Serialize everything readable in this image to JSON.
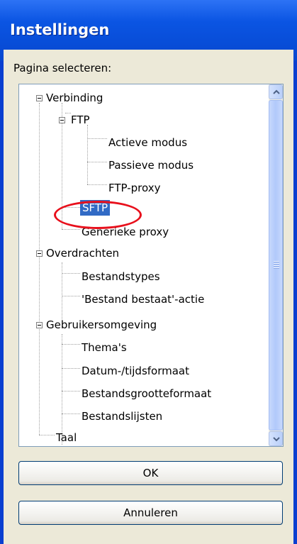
{
  "window": {
    "title": "Instellingen"
  },
  "page_select_label": "Pagina selecteren:",
  "tree": {
    "verbinding": "Verbinding",
    "ftp": "FTP",
    "actieve_modus": "Actieve modus",
    "passieve_modus": "Passieve modus",
    "ftp_proxy": "FTP-proxy",
    "sftp": "SFTP",
    "generieke_proxy": "Generieke proxy",
    "overdrachten": "Overdrachten",
    "bestandstypes": "Bestandstypes",
    "bestand_bestaat_actie": "'Bestand bestaat'-actie",
    "gebruikersomgeving": "Gebruikersomgeving",
    "themas": "Thema's",
    "datum_tijdsformaat": "Datum-/tijdsformaat",
    "bestandsgrootteformaat": "Bestandsgrootteformaat",
    "bestandslijsten": "Bestandslijsten",
    "taal": "Taal"
  },
  "selected_item": "SFTP",
  "buttons": {
    "ok": "OK",
    "cancel": "Annuleren"
  },
  "colors": {
    "titlebar": "#0b55e3",
    "selection": "#316ac5",
    "highlight_circle": "#e8101c",
    "dialog_bg": "#ece9d8"
  },
  "icons": {
    "expanded_node": "minus-box-icon",
    "scroll_up": "chevron-up-icon",
    "scroll_down": "chevron-down-icon"
  }
}
